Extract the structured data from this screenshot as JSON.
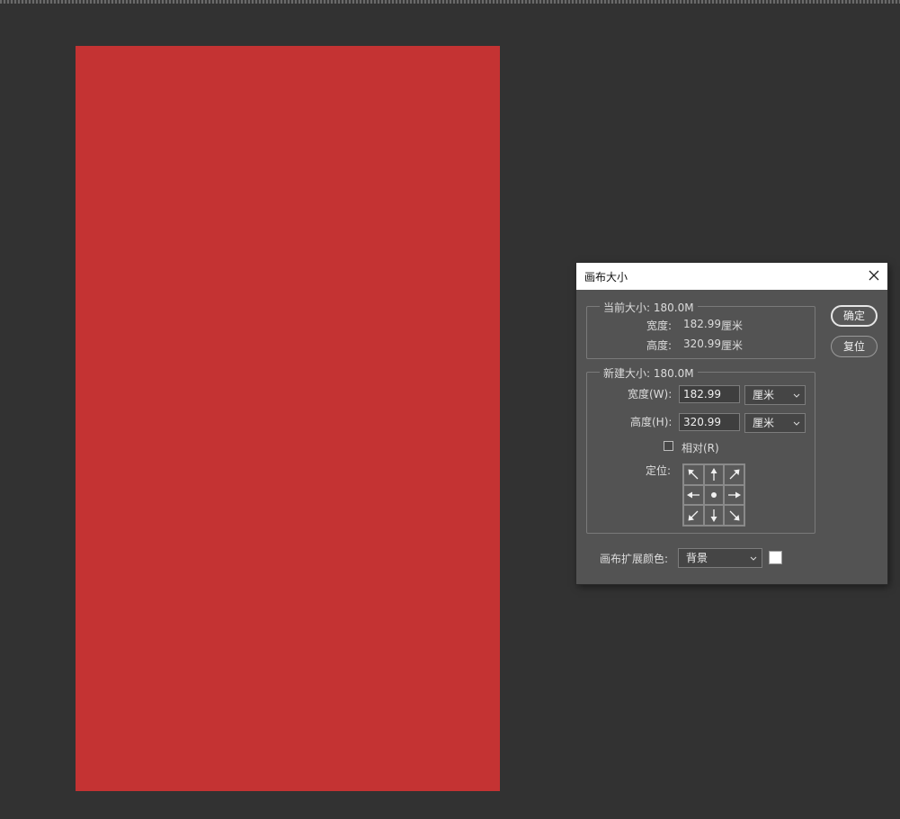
{
  "dialog": {
    "title": "画布大小",
    "ok_label": "确定",
    "reset_label": "复位"
  },
  "current_size": {
    "legend": "当前大小: 180.0M",
    "width_label": "宽度:",
    "width_value": "182.99",
    "width_unit": "厘米",
    "height_label": "高度:",
    "height_value": "320.99",
    "height_unit": "厘米"
  },
  "new_size": {
    "legend": "新建大小: 180.0M",
    "width_label": "宽度(W):",
    "width_value": "182.99",
    "width_unit": "厘米",
    "height_label": "高度(H):",
    "height_value": "320.99",
    "height_unit": "厘米",
    "relative_label": "相对(R)",
    "relative_checked": false,
    "anchor_label": "定位:",
    "anchor_selected": "center",
    "anchor_icons": [
      "arrow-up-left-icon",
      "arrow-up-icon",
      "arrow-up-right-icon",
      "arrow-left-icon",
      "center-dot-icon",
      "arrow-right-icon",
      "arrow-down-left-icon",
      "arrow-down-icon",
      "arrow-down-right-icon"
    ]
  },
  "extension_color": {
    "label": "画布扩展颜色:",
    "value": "背景",
    "swatch_color": "#ffffff"
  },
  "canvas": {
    "fill_color": "#c43333",
    "workspace_color": "#323232"
  }
}
